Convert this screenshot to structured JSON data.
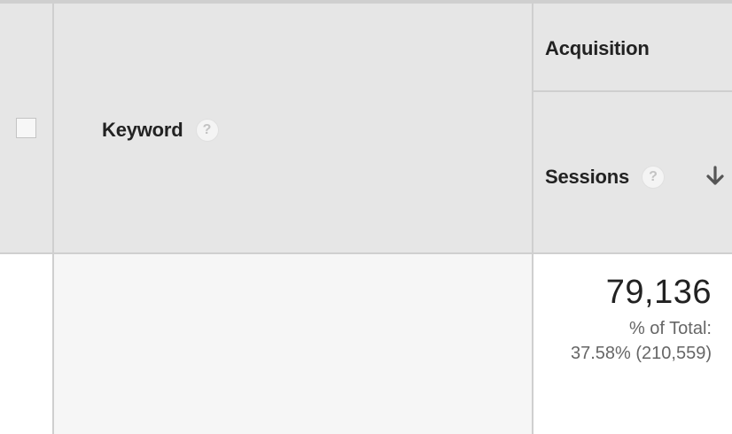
{
  "table": {
    "columns": {
      "keyword": {
        "label": "Keyword",
        "help_icon": "?"
      },
      "acquisition_group": {
        "label": "Acquisition"
      },
      "sessions": {
        "label": "Sessions",
        "help_icon": "?",
        "sort_icon": "arrow-down-icon",
        "sort_direction": "descending"
      }
    },
    "totals_row": {
      "sessions_value": "79,136",
      "sessions_pct_label": "% of Total:",
      "sessions_pct_value": "37.58% (210,559)"
    }
  },
  "colors": {
    "header_bg": "#e6e6e6",
    "border": "#cfcfcf",
    "row_bg": "#f6f6f6",
    "text_primary": "#222222",
    "text_secondary": "#666666"
  }
}
